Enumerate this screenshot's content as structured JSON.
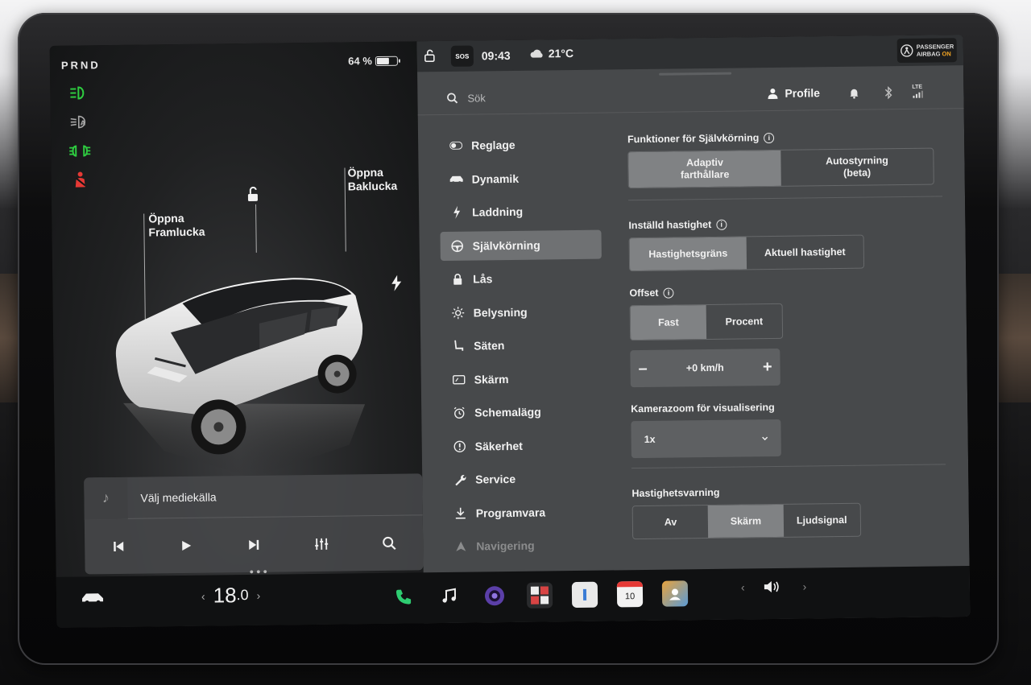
{
  "status_left": {
    "gear": "PRND",
    "battery_percent": "64 %",
    "battery_level": 0.64
  },
  "telltales": [
    {
      "icon": "headlight-icon",
      "color": "#2ecc40"
    },
    {
      "icon": "auto-highbeam-icon",
      "color": "#a8a8a8"
    },
    {
      "icon": "parking-lights-icon",
      "color": "#2ecc40"
    },
    {
      "icon": "seatbelt-warning-icon",
      "color": "#e53935"
    }
  ],
  "car_view": {
    "front_trunk_label": "Öppna\nFramlucka",
    "rear_trunk_label": "Öppna\nBaklucka"
  },
  "media": {
    "source_label": "Välj mediekälla"
  },
  "topbar": {
    "sos": "SOS",
    "time": "09:43",
    "temperature": "21°C",
    "airbag_line1": "PASSENGER",
    "airbag_line2": "AIRBAG",
    "airbag_state": "ON"
  },
  "search": {
    "placeholder": "Sök"
  },
  "header": {
    "profile_label": "Profile",
    "network": "LTE"
  },
  "nav": {
    "items": [
      {
        "label": "Reglage",
        "icon": "toggle-icon"
      },
      {
        "label": "Dynamik",
        "icon": "car-icon"
      },
      {
        "label": "Laddning",
        "icon": "bolt-icon"
      },
      {
        "label": "Självkörning",
        "icon": "steering-wheel-icon"
      },
      {
        "label": "Lås",
        "icon": "lock-icon"
      },
      {
        "label": "Belysning",
        "icon": "sun-icon"
      },
      {
        "label": "Säten",
        "icon": "seat-icon"
      },
      {
        "label": "Skärm",
        "icon": "display-icon"
      },
      {
        "label": "Schemalägg",
        "icon": "alarm-clock-icon"
      },
      {
        "label": "Säkerhet",
        "icon": "alert-circle-icon"
      },
      {
        "label": "Service",
        "icon": "wrench-icon"
      },
      {
        "label": "Programvara",
        "icon": "download-icon"
      },
      {
        "label": "Navigering",
        "icon": "navigation-icon"
      }
    ],
    "active_index": 3
  },
  "autopilot": {
    "features_title": "Funktioner för Självkörning",
    "features_options": [
      "Adaptiv\nfarthållare",
      "Autostyrning\n(beta)"
    ],
    "features_selected": 0,
    "set_speed_title": "Inställd hastighet",
    "set_speed_options": [
      "Hastighetsgräns",
      "Aktuell hastighet"
    ],
    "set_speed_selected": 0,
    "offset_title": "Offset",
    "offset_options": [
      "Fast",
      "Procent"
    ],
    "offset_selected": 0,
    "offset_value": "+0 km/h",
    "offset_minus": "–",
    "offset_plus": "+",
    "camera_zoom_title": "Kamerazoom för visualisering",
    "camera_zoom_value": "1x",
    "speed_warning_title": "Hastighetsvarning",
    "speed_warning_options": [
      "Av",
      "Skärm",
      "Ljudsignal"
    ],
    "speed_warning_selected": 1
  },
  "dock": {
    "cabin_temp": "18",
    "cabin_temp_decimal": ".0",
    "calendar_day": "10"
  },
  "colors": {
    "accent_green": "#2ecc40",
    "warning_red": "#e53935",
    "airbag_on": "#f5a623"
  }
}
